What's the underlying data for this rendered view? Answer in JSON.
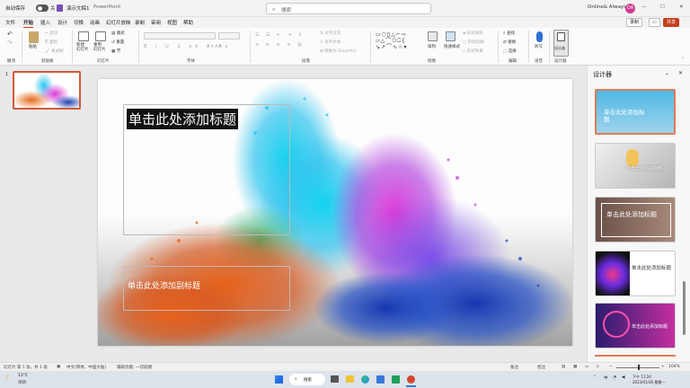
{
  "titlebar": {
    "autosave": "自动保存",
    "autosave_state": "关",
    "doc_title": "演示文稿1",
    "app_name": "PowerPoint",
    "search_placeholder": "搜索",
    "user_name": "Online& Always",
    "user_initials": "OA"
  },
  "menu": {
    "tabs": [
      "文件",
      "开始",
      "插入",
      "设计",
      "切换",
      "动画",
      "幻灯片放映",
      "录制",
      "审阅",
      "视图",
      "帮助"
    ],
    "active_tab": "开始",
    "record_label": "录制",
    "share_label": "共享"
  },
  "ribbon": {
    "clipboard": {
      "undo": "撤消",
      "paste": "粘贴",
      "cut": "剪切",
      "copy": "复制",
      "format_painter": "格式刷",
      "group": "剪贴板"
    },
    "slides": {
      "new_slide": "新建\n幻灯片",
      "reuse": "重用\n幻灯片",
      "layout": "版式",
      "reset": "重置",
      "section": "节",
      "group": "幻灯片"
    },
    "font": {
      "font_name": "",
      "font_size": "",
      "group": "字体"
    },
    "paragraph": {
      "text_direction": "文字方向",
      "align_text": "对齐文本",
      "smartart": "转换为 SmartArt",
      "group": "段落"
    },
    "drawing": {
      "arrange": "排列",
      "quick_styles": "快速样式",
      "shape_fill": "形状填充",
      "shape_outline": "形状轮廓",
      "shape_effects": "形状效果",
      "group": "绘图"
    },
    "editing": {
      "find": "查找",
      "replace": "替换",
      "select": "选择",
      "group": "编辑"
    },
    "voice": {
      "dictate": "听写",
      "group": "语音"
    },
    "designer": {
      "designer": "设计器",
      "group": "设计器"
    }
  },
  "thumbs": {
    "number": "1"
  },
  "slide": {
    "title": "单击此处添加标题",
    "subtitle": "单击此处添加副标题"
  },
  "designer_pane": {
    "title": "设计器",
    "items": [
      {
        "text": "单击此处添加标\n题"
      },
      {
        "text": "单击此处添加标题"
      },
      {
        "text": "单击此处添加标题"
      },
      {
        "text": "单击此处添加标题"
      },
      {
        "text": "单击此处添加标题"
      }
    ]
  },
  "statusbar": {
    "slide_count": "幻灯片 第 1 张，共 1 张",
    "language": "中文(简体，中国大陆)",
    "accessibility": "辅助功能: 一切就绪",
    "notes": "备注",
    "comments": "批注",
    "zoom": "104%"
  },
  "taskbar": {
    "weather_temp": "13°C",
    "weather_desc": "晴朗",
    "search": "搜索",
    "lang": "中",
    "time": "下午 11:24",
    "date": "2023/01/30 星期一"
  },
  "colors": {
    "accent": "#c43e1c",
    "taskbar": "#dde3ea"
  }
}
